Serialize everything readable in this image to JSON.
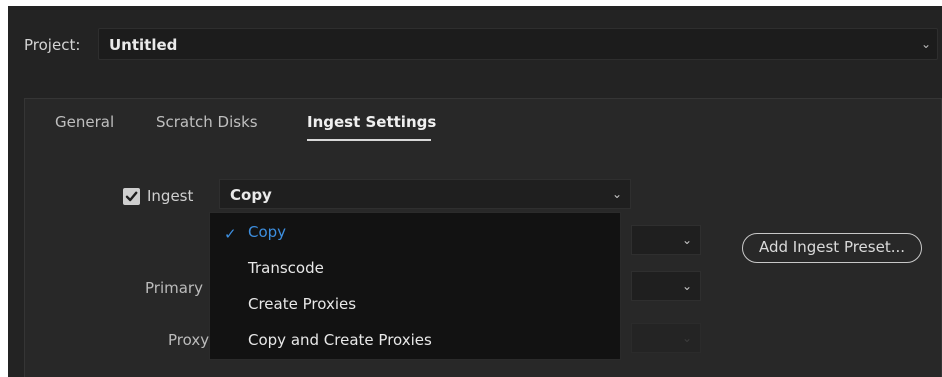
{
  "project": {
    "label": "Project:",
    "value": "Untitled"
  },
  "tabs": [
    {
      "label": "General",
      "active": false
    },
    {
      "label": "Scratch Disks",
      "active": false
    },
    {
      "label": "Ingest Settings",
      "active": true
    }
  ],
  "ingest": {
    "checkbox_label": "Ingest",
    "checked": true,
    "selected_value": "Copy",
    "options": [
      {
        "label": "Copy",
        "selected": true
      },
      {
        "label": "Transcode",
        "selected": false
      },
      {
        "label": "Create Proxies",
        "selected": false
      },
      {
        "label": "Copy and Create Proxies",
        "selected": false
      }
    ]
  },
  "labels": {
    "primary": "Primary",
    "proxy": "Proxy"
  },
  "buttons": {
    "add_ingest_preset": "Add Ingest Preset..."
  },
  "icons": {
    "check": "✓",
    "chevron": "⌄"
  },
  "colors": {
    "background": "#232323",
    "accent_selected": "#3d8fe0"
  }
}
